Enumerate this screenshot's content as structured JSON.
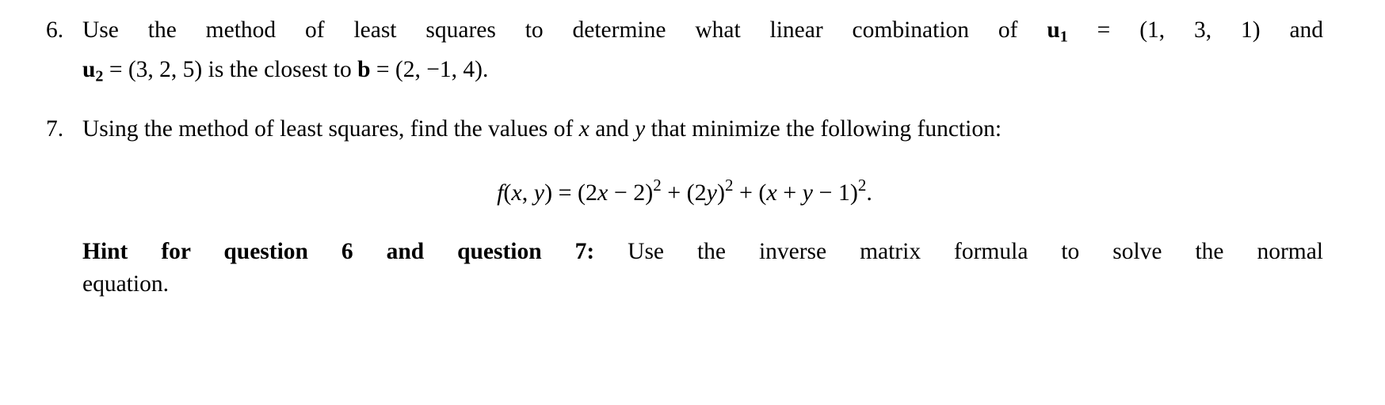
{
  "document": {
    "type": "math-exercise-sheet",
    "background_color": "#ffffff",
    "text_color": "#000000"
  },
  "questions": [
    {
      "number": "6.",
      "line1_prefix": "Use the method of least squares to determine what linear combination of",
      "vector_u1": {
        "symbol": "u",
        "subscript": "1",
        "equals": "=",
        "value": "(1, 3, 1)"
      },
      "line1_suffix": "and",
      "vector_u2": {
        "symbol": "u",
        "subscript": "2",
        "equals": "=",
        "value": "(3, 2, 5)"
      },
      "line2_middle": "is the closest to",
      "vector_b": {
        "symbol": "b",
        "equals": "=",
        "value": "(2, −1, 4)"
      },
      "line2_end": ".",
      "plain_text": "6. Use the method of least squares to determine what linear combination of u₁ = (1, 3, 1) and u₂ = (3, 2, 5) is the closest to b = (2, −1, 4)."
    },
    {
      "number": "7.",
      "text_part1": "Using the method of least squares, find the values of",
      "var_x": "x",
      "text_part2": "and",
      "var_y": "y",
      "text_part3": "that minimize the following function:",
      "plain_text": "7. Using the method of least squares, find the values of x and y that minimize the following function:"
    }
  ],
  "equation": {
    "function_name": "f",
    "open_paren": "(",
    "arg1": "x",
    "comma": ",",
    "arg2": "y",
    "close_paren": ")",
    "equals": "=",
    "term1": {
      "open": "(",
      "coef": "2",
      "var": "x",
      "op": "−",
      "const": "2",
      "close": ")",
      "power": "2"
    },
    "plus1": "+",
    "term2": {
      "open": "(",
      "coef": "2",
      "var": "y",
      "close": ")",
      "power": "2"
    },
    "plus2": "+",
    "term3": {
      "open": "(",
      "var1": "x",
      "op1": "+",
      "var2": "y",
      "op2": "−",
      "const": "1",
      "close": ")",
      "power": "2"
    },
    "period": ".",
    "plain_text": "f(x, y) = (2x − 2)² + (2y)² + (x + y − 1)²."
  },
  "hint": {
    "label": "Hint for question 6 and question 7:",
    "line1_text": "Use the inverse matrix formula to solve the normal",
    "line2_text": "equation.",
    "plain_text": "Hint for question 6 and question 7: Use the inverse matrix formula to solve the normal equation."
  }
}
